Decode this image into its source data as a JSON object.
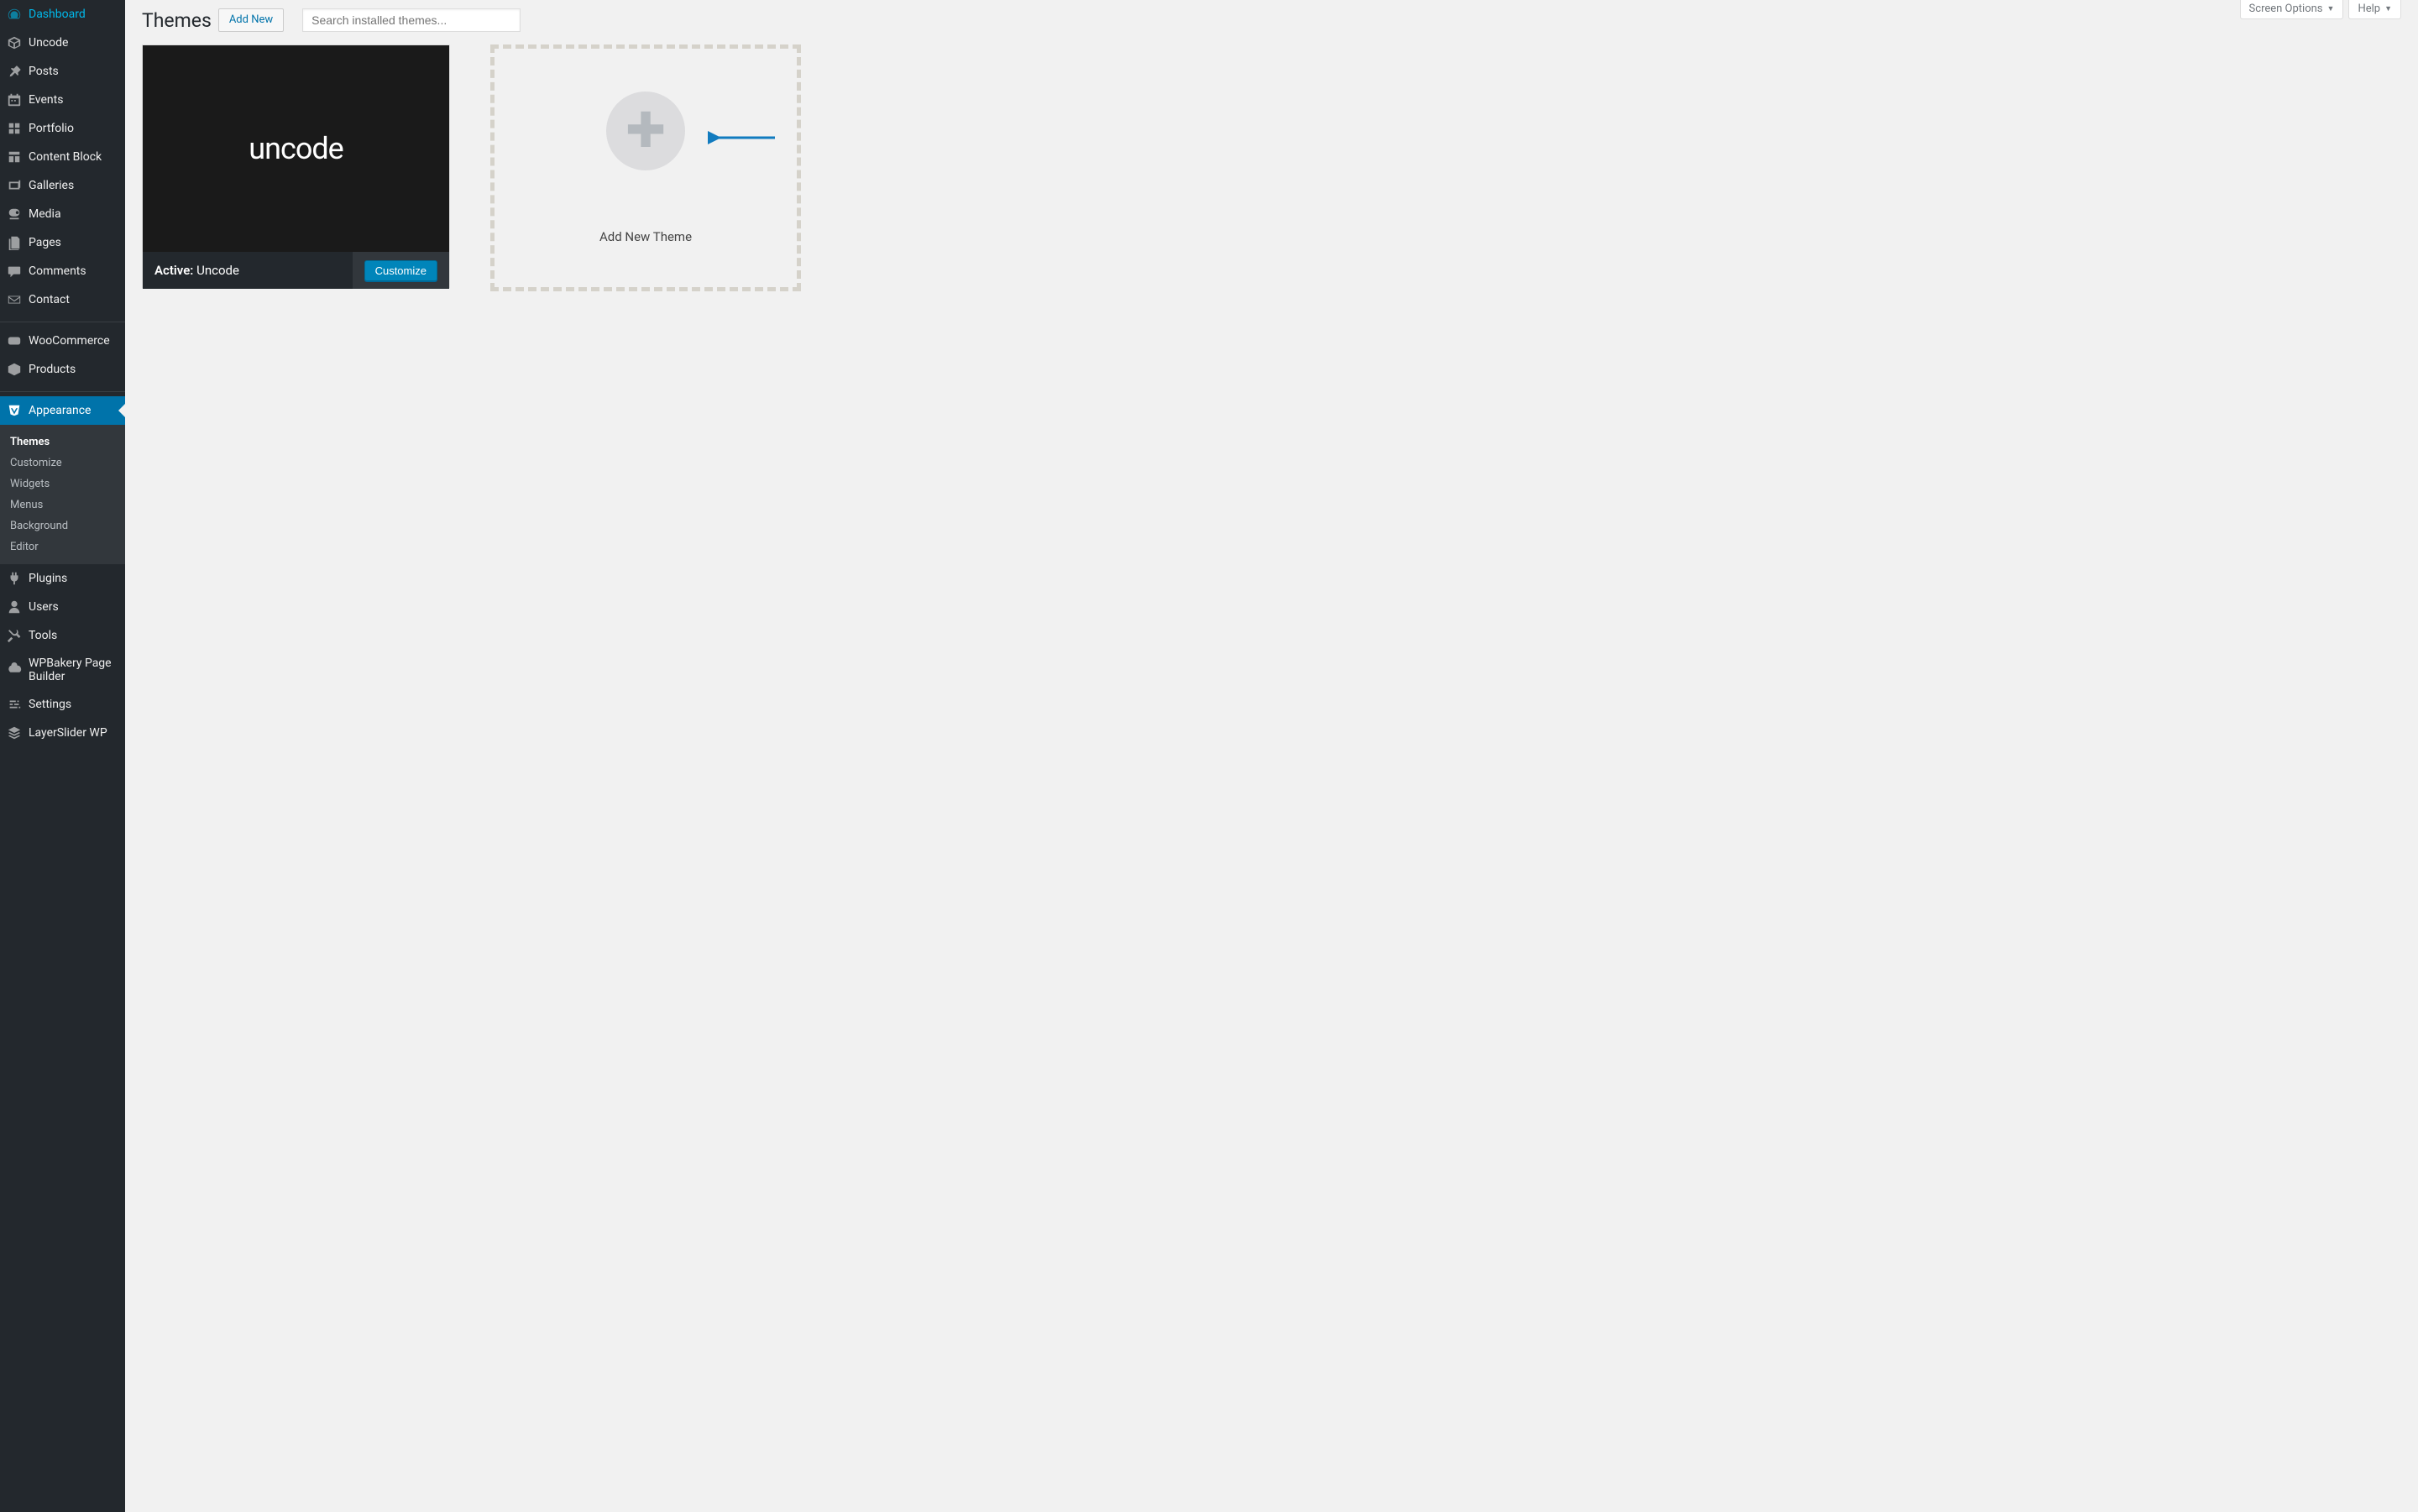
{
  "sidebar": {
    "items": [
      {
        "label": "Dashboard",
        "icon": "dashboard"
      },
      {
        "label": "Uncode",
        "icon": "uncode"
      },
      {
        "label": "Posts",
        "icon": "pin"
      },
      {
        "label": "Events",
        "icon": "calendar"
      },
      {
        "label": "Portfolio",
        "icon": "portfolio"
      },
      {
        "label": "Content Block",
        "icon": "contentblock"
      },
      {
        "label": "Galleries",
        "icon": "galleries"
      },
      {
        "label": "Media",
        "icon": "media"
      },
      {
        "label": "Pages",
        "icon": "pages"
      },
      {
        "label": "Comments",
        "icon": "comments"
      },
      {
        "label": "Contact",
        "icon": "contact"
      }
    ],
    "items2": [
      {
        "label": "WooCommerce",
        "icon": "woocommerce"
      },
      {
        "label": "Products",
        "icon": "products"
      }
    ],
    "appearance": {
      "label": "Appearance",
      "icon": "appearance"
    },
    "submenu": [
      {
        "label": "Themes",
        "current": true
      },
      {
        "label": "Customize"
      },
      {
        "label": "Widgets"
      },
      {
        "label": "Menus"
      },
      {
        "label": "Background"
      },
      {
        "label": "Editor"
      }
    ],
    "items3": [
      {
        "label": "Plugins",
        "icon": "plugins"
      },
      {
        "label": "Users",
        "icon": "users"
      },
      {
        "label": "Tools",
        "icon": "tools"
      },
      {
        "label": "WPBakery Page Builder",
        "icon": "wpbakery"
      },
      {
        "label": "Settings",
        "icon": "settings"
      },
      {
        "label": "LayerSlider WP",
        "icon": "layerslider"
      }
    ]
  },
  "header": {
    "title": "Themes",
    "add_new": "Add New",
    "search_placeholder": "Search installed themes...",
    "screen_options": "Screen Options",
    "help": "Help"
  },
  "theme": {
    "logo": "uncode",
    "active_label": "Active:",
    "name": "Uncode",
    "customize": "Customize"
  },
  "add_theme": {
    "label": "Add New Theme"
  },
  "colors": {
    "accent": "#0073aa",
    "arrow": "#117bbf"
  }
}
